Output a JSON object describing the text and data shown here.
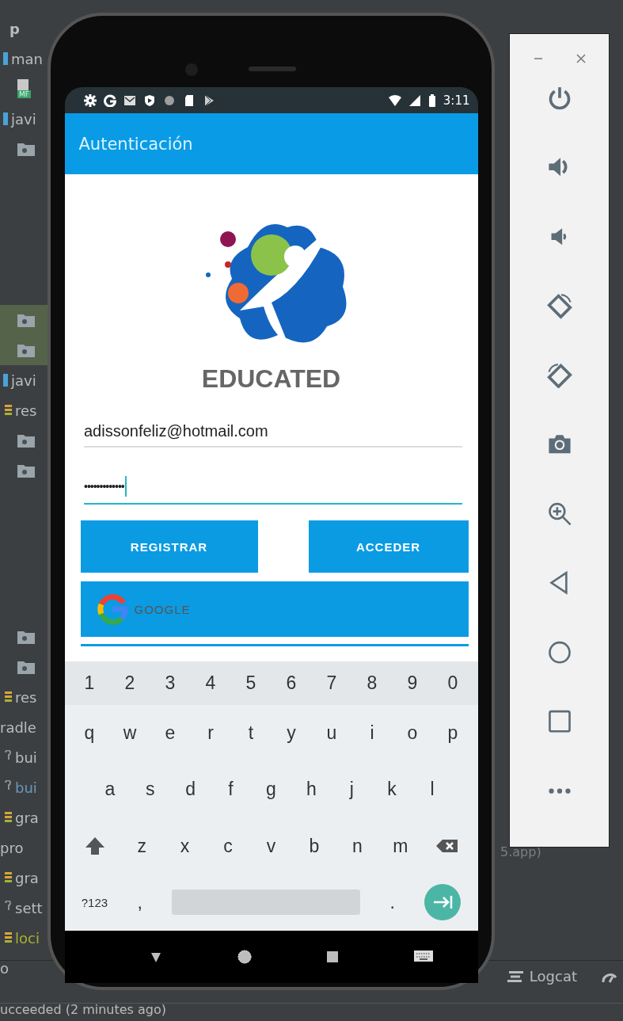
{
  "project_tree": [
    {
      "items": [
        {
          "kind": "module",
          "label": "p",
          "color": "#bbbbbb",
          "selected": false
        },
        {
          "kind": "dir",
          "label": "man",
          "color": "#bbbbbb",
          "selected": false
        },
        {
          "kind": "manifest",
          "label": "MF",
          "selected": false
        },
        {
          "kind": "dir",
          "label": "javi",
          "color": "#bbbbbb",
          "selected": false
        },
        {
          "kind": "package",
          "selected": false
        }
      ]
    },
    {
      "items": [
        {
          "kind": "package",
          "selected": true
        },
        {
          "kind": "package",
          "selected": true
        },
        {
          "kind": "dir",
          "label": "javi",
          "color": "#bbbbbb",
          "selected": false
        },
        {
          "kind": "gradle",
          "label": "res",
          "color": "#bbbbbb",
          "selected": false
        },
        {
          "kind": "package",
          "selected": false
        },
        {
          "kind": "package",
          "selected": false
        }
      ]
    },
    {
      "items": [
        {
          "kind": "package",
          "selected": false
        },
        {
          "kind": "package",
          "selected": false
        },
        {
          "kind": "gradle",
          "label": "res",
          "color": "#bbbbbb",
          "selected": false
        },
        {
          "kind": "plain",
          "label": "radle",
          "color": "#bbbbbb",
          "selected": false
        },
        {
          "kind": "script",
          "label": "bui",
          "color": "#bbbbbb",
          "selected": false
        },
        {
          "kind": "script",
          "label": "bui",
          "color": "#6897bb",
          "selected": false
        },
        {
          "kind": "gradle",
          "label": "gra",
          "color": "#bbbbbb",
          "selected": false
        },
        {
          "kind": "plain",
          "label": "pro",
          "color": "#bbbbbb",
          "selected": false
        },
        {
          "kind": "gradle",
          "label": "gra",
          "color": "#bbbbbb",
          "selected": false
        },
        {
          "kind": "script",
          "label": "sett",
          "color": "#bbbbbb",
          "selected": false
        },
        {
          "kind": "gradle",
          "label": "loci",
          "color": "#a8b02d",
          "selected": false
        },
        {
          "kind": "plain",
          "label": "o",
          "color": "#bbbbbb",
          "selected": false
        }
      ]
    }
  ],
  "run_output": {
    "text": "5.app)"
  },
  "bottom_toolbar": {
    "logcat": "Logcat"
  },
  "ide_status_bar": {
    "text": "ucceeded (2 minutes ago)"
  },
  "phone": {
    "status_bar": {
      "time": "3:11"
    },
    "app_bar": {
      "title": "Autenticación"
    },
    "logo": {
      "text": "EDUCATED"
    },
    "email_field": {
      "value": "adissonfeliz@hotmail.com",
      "focused": false
    },
    "password_field": {
      "value": "•••••••••••••",
      "focused": true
    },
    "buttons": {
      "register": "REGISTRAR",
      "login": "ACCEDER",
      "google": "GOOGLE"
    },
    "keyboard": {
      "rows": [
        [
          {
            "kind": "char",
            "label": "1"
          },
          {
            "kind": "char",
            "label": "2"
          },
          {
            "kind": "char",
            "label": "3"
          },
          {
            "kind": "char",
            "label": "4"
          },
          {
            "kind": "char",
            "label": "5"
          },
          {
            "kind": "char",
            "label": "6"
          },
          {
            "kind": "char",
            "label": "7"
          },
          {
            "kind": "char",
            "label": "8"
          },
          {
            "kind": "char",
            "label": "9"
          },
          {
            "kind": "char",
            "label": "0"
          }
        ],
        [
          {
            "kind": "char",
            "label": "q"
          },
          {
            "kind": "char",
            "label": "w"
          },
          {
            "kind": "char",
            "label": "e"
          },
          {
            "kind": "char",
            "label": "r"
          },
          {
            "kind": "char",
            "label": "t"
          },
          {
            "kind": "char",
            "label": "y"
          },
          {
            "kind": "char",
            "label": "u"
          },
          {
            "kind": "char",
            "label": "i"
          },
          {
            "kind": "char",
            "label": "o"
          },
          {
            "kind": "char",
            "label": "p"
          }
        ],
        [
          {
            "kind": "char",
            "label": "a"
          },
          {
            "kind": "char",
            "label": "s"
          },
          {
            "kind": "char",
            "label": "d"
          },
          {
            "kind": "char",
            "label": "f"
          },
          {
            "kind": "char",
            "label": "g"
          },
          {
            "kind": "char",
            "label": "h"
          },
          {
            "kind": "char",
            "label": "j"
          },
          {
            "kind": "char",
            "label": "k"
          },
          {
            "kind": "char",
            "label": "l"
          }
        ],
        [
          {
            "kind": "shift"
          },
          {
            "kind": "char",
            "label": "z"
          },
          {
            "kind": "char",
            "label": "x"
          },
          {
            "kind": "char",
            "label": "c"
          },
          {
            "kind": "char",
            "label": "v"
          },
          {
            "kind": "char",
            "label": "b"
          },
          {
            "kind": "char",
            "label": "n"
          },
          {
            "kind": "char",
            "label": "m"
          },
          {
            "kind": "backspace"
          }
        ],
        [
          {
            "kind": "symbols",
            "label": "?123"
          },
          {
            "kind": "char",
            "label": ","
          },
          {
            "kind": "space"
          },
          {
            "kind": "char",
            "label": "."
          },
          {
            "kind": "enter"
          }
        ]
      ]
    }
  }
}
